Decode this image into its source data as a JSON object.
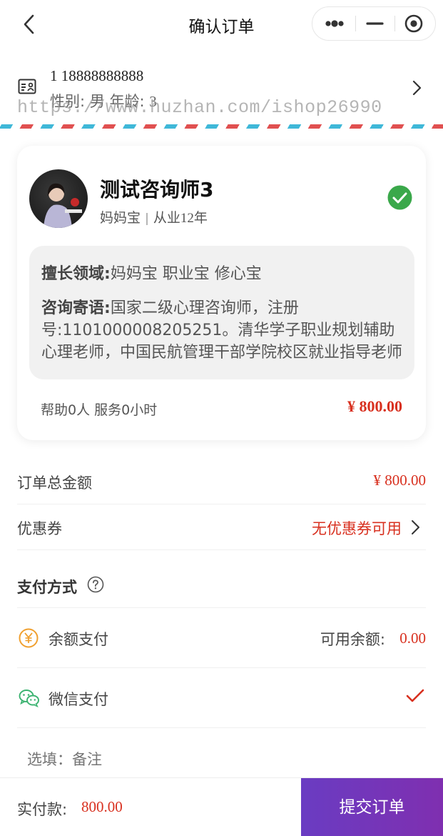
{
  "nav": {
    "title": "确认订单"
  },
  "patient": {
    "name_line": "1 18888888888",
    "gender_label": "性别:",
    "gender": "男",
    "age_label": "年龄:",
    "age": "3"
  },
  "watermark": "https://www.huzhan.com/ishop26990",
  "counselor": {
    "name": "测试咨询师3",
    "tag": "妈妈宝",
    "separator": "|",
    "experience": "从业12年",
    "expertise_label": "擅长领域:",
    "expertise": "妈妈宝 职业宝 修心宝",
    "motto_label": "咨询寄语:",
    "motto": "国家二级心理咨询师，注册号:1101000008205251。清华学子职业规划辅助心理老师，中国民航管理干部学院校区就业指导老师",
    "stats": "帮助0人 服务0小时",
    "price": "¥ 800.00"
  },
  "order": {
    "total_label": "订单总金额",
    "total": "¥ 800.00",
    "coupon_label": "优惠券",
    "coupon_value": "无优惠券可用"
  },
  "payment": {
    "title": "支付方式",
    "balance_label": "余额支付",
    "balance_avail_label": "可用余额:",
    "balance_avail": "0.00",
    "wechat_label": "微信支付"
  },
  "remark": {
    "placeholder": "选填：备注"
  },
  "bottom": {
    "pay_label": "实付款:",
    "pay_amount": "800.00",
    "submit_label": "提交订单"
  },
  "colors": {
    "accent_red": "#d8301f",
    "submit_purple": "#6a3cc2",
    "check_green": "#3aa84a",
    "wechat_green": "#3cb371",
    "balance_orange": "#f0a030"
  }
}
